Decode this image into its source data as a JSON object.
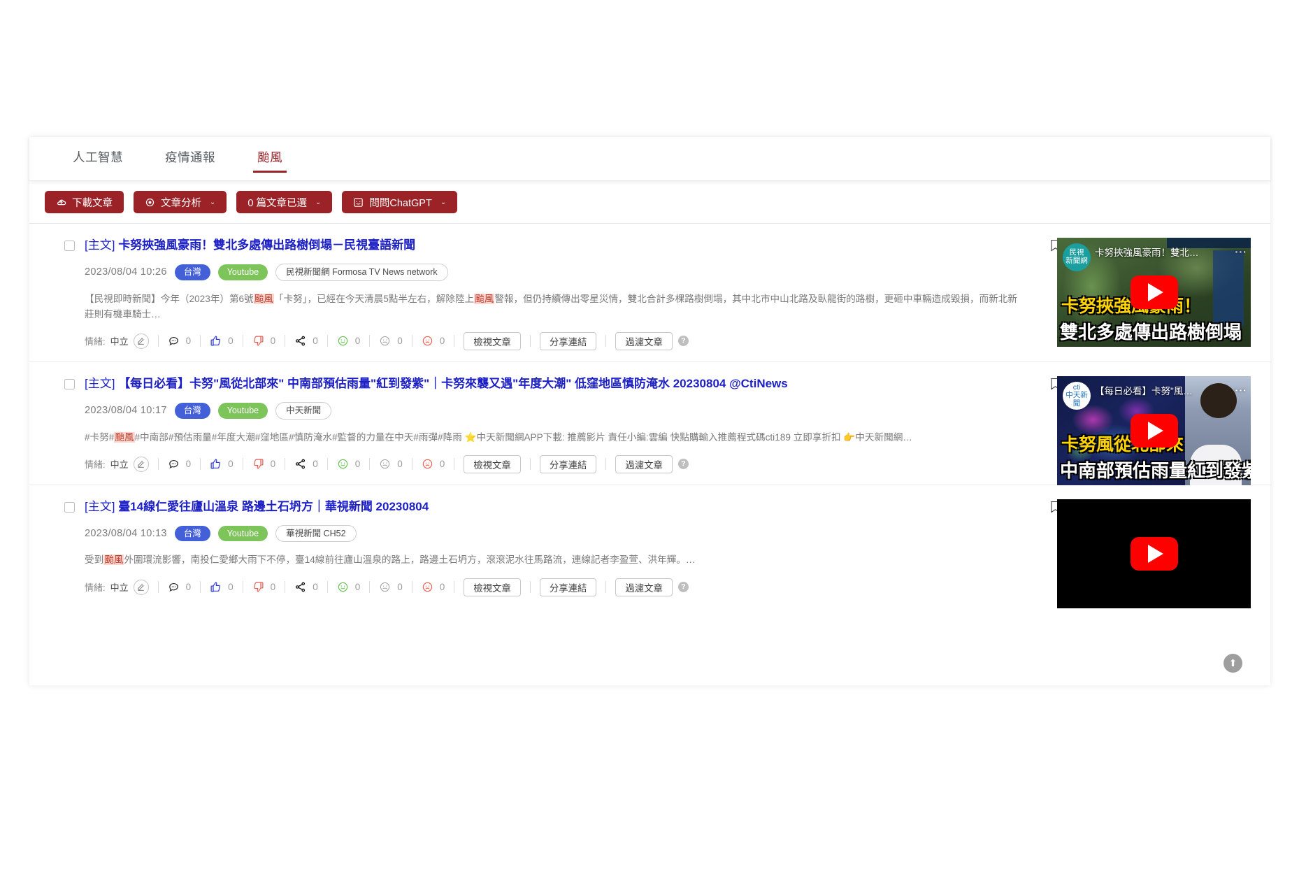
{
  "tabs": [
    {
      "label": "人工智慧",
      "active": false
    },
    {
      "label": "疫情通報",
      "active": false
    },
    {
      "label": "颱風",
      "active": true
    }
  ],
  "toolbar": {
    "download_label": "下載文章",
    "analysis_label": "文章分析",
    "selected_label": "0 篇文章已選",
    "chatgpt_label": "問問ChatGPT",
    "caret": "⌄",
    "accent_color": "#9b2226"
  },
  "action_labels": {
    "sentiment_prefix": "情緒:",
    "view_article": "檢視文章",
    "share_link": "分享連結",
    "filter_article": "過濾文章",
    "help": "?"
  },
  "articles": [
    {
      "tag": "[主文]",
      "title": "卡努挾強風豪雨！雙北多處傳出路樹倒塌－民視臺語新聞",
      "date": "2023/08/04 10:26",
      "pills": [
        {
          "text": "台灣",
          "style": "blue"
        },
        {
          "text": "Youtube",
          "style": "green"
        },
        {
          "text": "民視新聞網 Formosa TV News network",
          "style": "outline"
        }
      ],
      "summary_parts": [
        {
          "t": "【民視即時新聞】今年（2023年）第6號",
          "hl": false
        },
        {
          "t": "颱風",
          "hl": true
        },
        {
          "t": "「卡努」，已經在今天清晨5點半左右，解除陸上",
          "hl": false
        },
        {
          "t": "颱風",
          "hl": true
        },
        {
          "t": "警報，但仍持續傳出零星災情，雙北合計多棵路樹倒塌，其中北市中山北路及臥龍街的路樹，更砸中車輛造成毀損，而新北新莊則有機車騎士…",
          "hl": false
        }
      ],
      "sentiment": "中立",
      "counts": {
        "comment": "0",
        "like": "0",
        "dislike": "0",
        "share": "0",
        "positive": "0",
        "neutral": "0",
        "negative": "0"
      },
      "thumbnail": {
        "style": "a",
        "overlay_title": "卡努挾強風豪雨！雙北…",
        "logo_line1": "民視",
        "logo_line2": "新聞網",
        "logo_color": "#1b9e9e",
        "kicker1": "卡努挾強風豪雨！",
        "kicker2": "雙北多處傳出路樹倒塌"
      }
    },
    {
      "tag": "[主文]",
      "title": "【每日必看】卡努\"風從北部來\" 中南部預估雨量\"紅到發紫\"｜卡努來襲又遇\"年度大潮\" 低窪地區慎防淹水 20230804 @CtiNews",
      "date": "2023/08/04 10:17",
      "pills": [
        {
          "text": "台灣",
          "style": "blue"
        },
        {
          "text": "Youtube",
          "style": "green"
        },
        {
          "text": "中天新聞",
          "style": "outline"
        }
      ],
      "summary_parts": [
        {
          "t": "#卡努#",
          "hl": false
        },
        {
          "t": "颱風",
          "hl": true
        },
        {
          "t": "#中南部#預估雨量#年度大潮#窪地區#慎防淹水#監督的力量在中天#雨彈#降雨 ⭐中天新聞網APP下載: 推薦影片 責任小編:雲編 快點購輸入推薦程式碼cti189 立即享折扣 👉中天新聞網…",
          "hl": false
        }
      ],
      "sentiment": "中立",
      "counts": {
        "comment": "0",
        "like": "0",
        "dislike": "0",
        "share": "0",
        "positive": "0",
        "neutral": "0",
        "negative": "0"
      },
      "thumbnail": {
        "style": "b",
        "overlay_title": "【每日必看】卡努\"風…",
        "logo_line1": "cti",
        "logo_line2": "中天新聞",
        "logo_color": "#ffffff",
        "kicker1": "卡努風從北部來",
        "kicker2": "中南部預估雨量紅到發紫"
      }
    },
    {
      "tag": "[主文]",
      "title": "臺14線仁愛往廬山溫泉 路邊土石坍方｜華視新聞 20230804",
      "date": "2023/08/04 10:13",
      "pills": [
        {
          "text": "台灣",
          "style": "blue"
        },
        {
          "text": "Youtube",
          "style": "green"
        },
        {
          "text": "華視新聞 CH52",
          "style": "outline"
        }
      ],
      "summary_parts": [
        {
          "t": "受到",
          "hl": false
        },
        {
          "t": "颱風",
          "hl": true
        },
        {
          "t": "外圍環流影響，南投仁愛鄉大雨下不停，臺14線前往廬山溫泉的路上，路邊土石坍方，滾滾泥水往馬路流，連線記者李盈萱、洪年輝。…",
          "hl": false
        }
      ],
      "sentiment": "中立",
      "counts": {
        "comment": "0",
        "like": "0",
        "dislike": "0",
        "share": "0",
        "positive": "0",
        "neutral": "0",
        "negative": "0"
      },
      "thumbnail": {
        "style": "black",
        "overlay_title": "",
        "logo_line1": "",
        "logo_line2": "",
        "logo_color": "#000000",
        "kicker1": "",
        "kicker2": ""
      }
    }
  ],
  "scroll_top_icon": "⬆"
}
